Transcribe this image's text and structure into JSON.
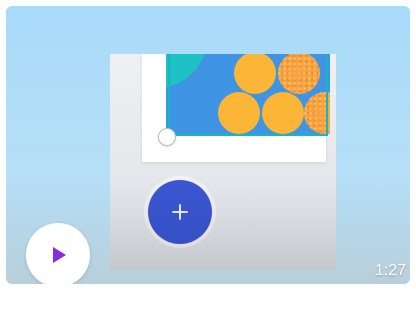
{
  "video_card": {
    "duration": "1:27",
    "play_icon": "play-icon",
    "add_icon": "plus-icon",
    "colors": {
      "background_top": "#a8daf9",
      "accent_teal": "#16b7c1",
      "fab_blue": "#3a56d2",
      "play_purple": "#8a2be2",
      "orange": "#fbb637"
    }
  }
}
